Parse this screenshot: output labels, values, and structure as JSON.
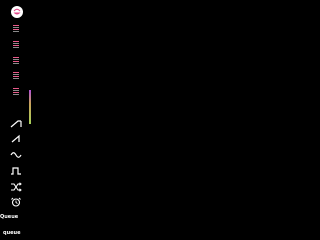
{
  "sidebar": {
    "logo_icon": "face-logo-icon",
    "patterns": [
      {
        "icon": "pattern-stripes-icon"
      },
      {
        "icon": "pattern-stripes-icon"
      },
      {
        "icon": "pattern-stripes-icon"
      },
      {
        "icon": "pattern-stripes-icon"
      },
      {
        "icon": "pattern-stripes-icon"
      },
      {
        "icon": "pattern-stripes-icon"
      }
    ],
    "level_meter": {
      "level": 1.0
    },
    "tools": [
      {
        "icon": "ramp-icon"
      },
      {
        "icon": "sawtooth-icon"
      },
      {
        "icon": "sine-wave-icon"
      },
      {
        "icon": "square-wave-icon"
      },
      {
        "icon": "shuffle-icon"
      },
      {
        "icon": "alarm-clock-icon"
      }
    ],
    "queue_label": "Queue",
    "queue_sub_label": "queue"
  },
  "colors": {
    "background": "#000000",
    "stripe_pink": "#e85a8a",
    "stripe_grey": "#8a8a8a",
    "meter_top": "#b14fd8",
    "meter_bottom": "#a7d15a",
    "text": "#ffffff"
  }
}
